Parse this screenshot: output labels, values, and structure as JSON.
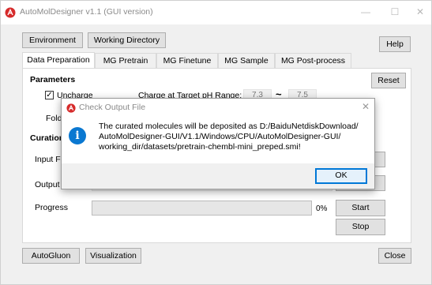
{
  "window": {
    "title": "AutoMolDesigner v1.1 (GUI version)",
    "min": "—",
    "max": "☐",
    "close": "✕"
  },
  "toolbar": {
    "environment": "Environment",
    "working_directory": "Working Directory",
    "help": "Help"
  },
  "tabs": [
    "Data Preparation",
    "MG Pretrain",
    "MG Finetune",
    "MG Sample",
    "MG Post-process"
  ],
  "parameters": {
    "heading": "Parameters",
    "reset": "Reset",
    "uncharge_label": "Uncharge",
    "uncharge_checked": "✓",
    "charge_range_label": "Charge at Target pH Range:",
    "charge_min": "7.3",
    "tilde": "~",
    "charge_max": "7.5",
    "fold_label": "Fold"
  },
  "curation": {
    "heading": "Curation",
    "input_label": "Input F",
    "output_label": "Output",
    "progress_label": "Progress",
    "progress_value": 0,
    "progress_text": "0%",
    "start": "Start",
    "stop": "Stop"
  },
  "bottom": {
    "autogluon": "AutoGluon",
    "visualization": "Visualization",
    "close": "Close"
  },
  "dialog": {
    "title": "Check Output File",
    "close": "✕",
    "icon": "i",
    "message_line1": "The curated molecules will be deposited as D:/BaiduNetdiskDownload/",
    "message_line2": "AutoMolDesigner-GUI/V1.1/Windows/CPU/AutoMolDesigner-GUI/",
    "message_line3": "working_dir/datasets/pretrain-chembl-mini_preped.smi!",
    "ok": "OK"
  },
  "colors": {
    "accent": "#0078d7",
    "info": "#0a78d1",
    "app_icon": "#d62b2b"
  }
}
